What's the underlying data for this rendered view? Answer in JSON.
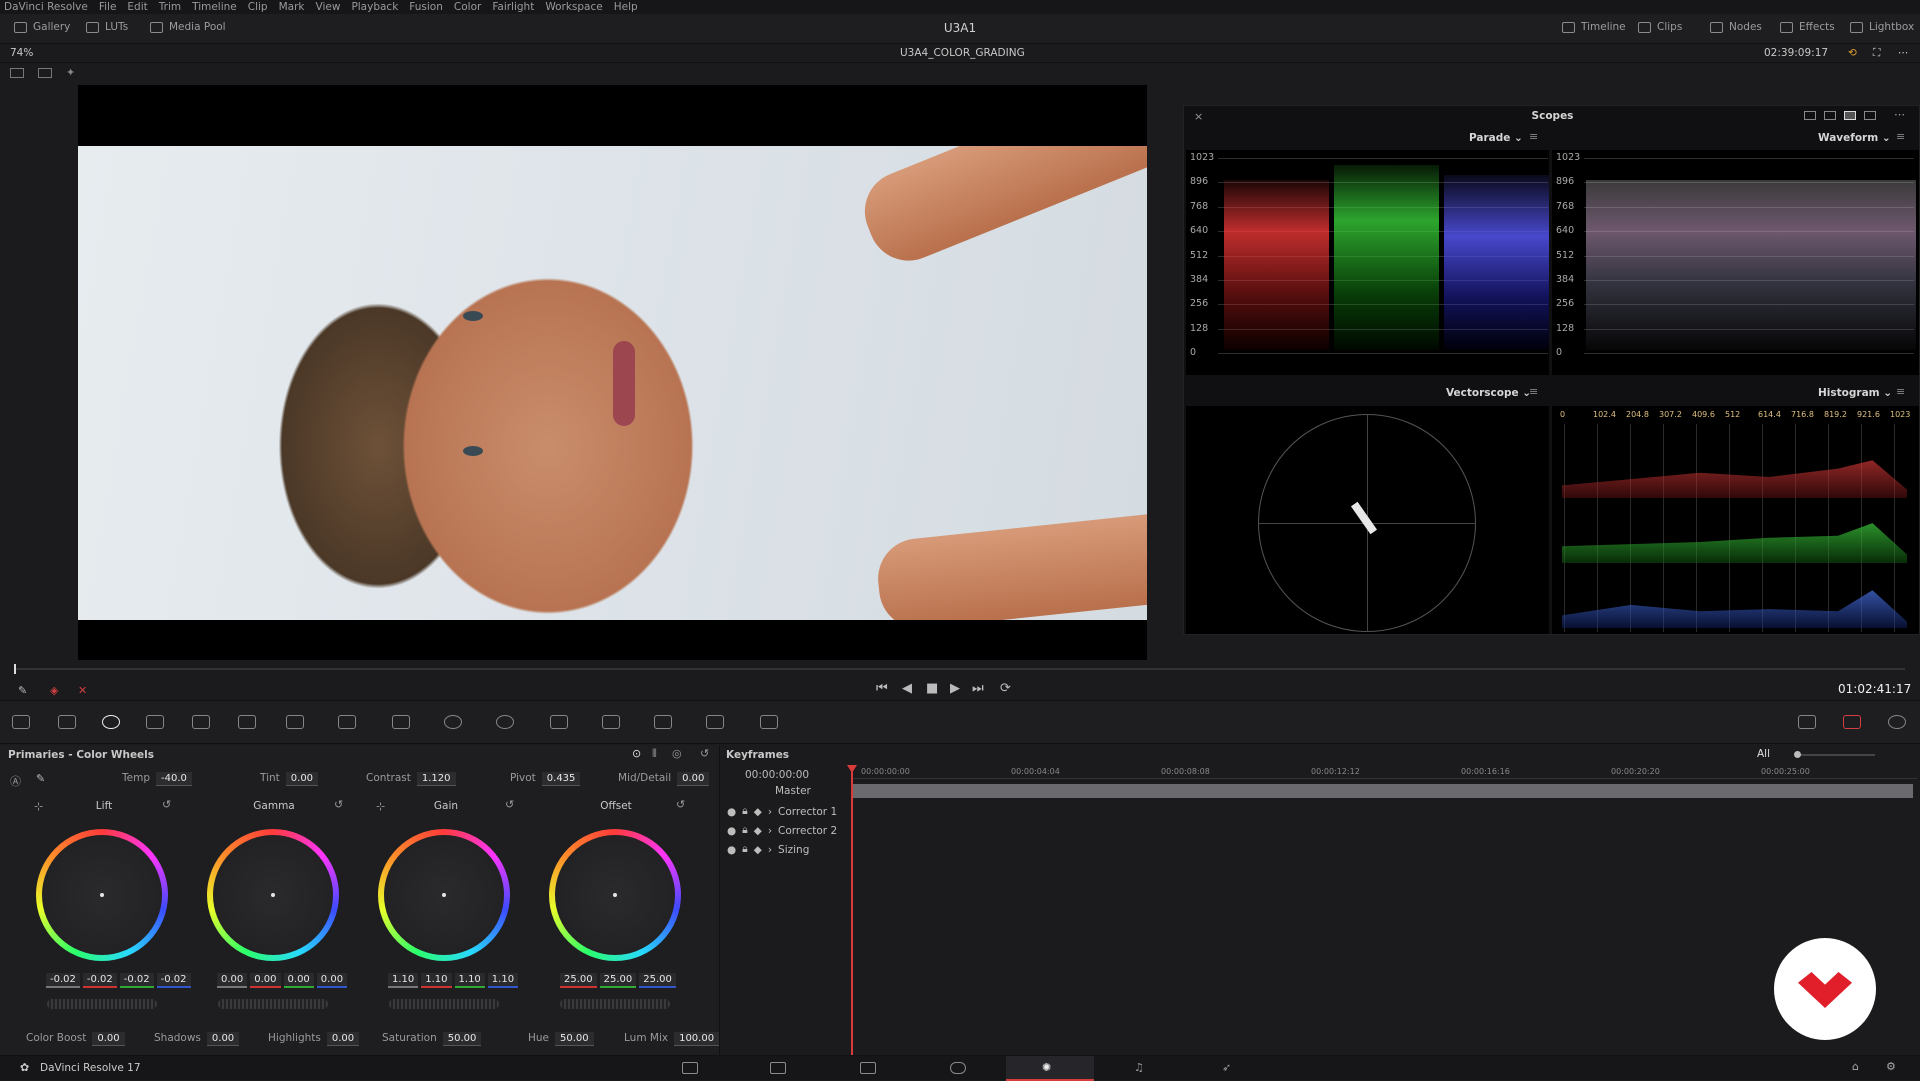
{
  "menu": [
    "DaVinci Resolve",
    "File",
    "Edit",
    "Trim",
    "Timeline",
    "Clip",
    "Mark",
    "View",
    "Playback",
    "Fusion",
    "Color",
    "Fairlight",
    "Workspace",
    "Help"
  ],
  "toolbar": {
    "left": [
      {
        "label": "Gallery",
        "icon": "gallery-icon"
      },
      {
        "label": "LUTs",
        "icon": "luts-icon"
      },
      {
        "label": "Media Pool",
        "icon": "media-pool-icon"
      }
    ],
    "title": "U3A1",
    "right": [
      {
        "label": "Timeline",
        "icon": "timeline-icon"
      },
      {
        "label": "Clips",
        "icon": "clips-icon"
      },
      {
        "label": "Nodes",
        "icon": "nodes-icon"
      },
      {
        "label": "Effects",
        "icon": "effects-icon"
      },
      {
        "label": "Lightbox",
        "icon": "lightbox-icon"
      }
    ]
  },
  "viewer": {
    "zoom": "74%",
    "timeline_name": "U3A4_COLOR_GRADING",
    "timecode": "02:39:09:17"
  },
  "scopes": {
    "title": "Scopes",
    "parade_label": "Parade",
    "waveform_label": "Waveform",
    "vectorscope_label": "Vectorscope",
    "histogram_label": "Histogram",
    "y_ticks": [
      "1023",
      "896",
      "768",
      "640",
      "512",
      "384",
      "256",
      "128",
      "0"
    ],
    "hist_ticks": [
      "0",
      "102.4",
      "204.8",
      "307.2",
      "409.6",
      "512",
      "614.4",
      "716.8",
      "819.2",
      "921.6",
      "1023"
    ]
  },
  "transport": {
    "timecode": "01:02:41:17"
  },
  "primaries": {
    "title": "Primaries - Color Wheels",
    "top_params": [
      {
        "label": "Temp",
        "value": "-40.0"
      },
      {
        "label": "Tint",
        "value": "0.00"
      },
      {
        "label": "Contrast",
        "value": "1.120"
      },
      {
        "label": "Pivot",
        "value": "0.435"
      },
      {
        "label": "Mid/Detail",
        "value": "0.00"
      }
    ],
    "wheels": [
      {
        "label": "Lift",
        "values": [
          "-0.02",
          "-0.02",
          "-0.02",
          "-0.02"
        ]
      },
      {
        "label": "Gamma",
        "values": [
          "0.00",
          "0.00",
          "0.00",
          "0.00"
        ]
      },
      {
        "label": "Gain",
        "values": [
          "1.10",
          "1.10",
          "1.10",
          "1.10"
        ]
      },
      {
        "label": "Offset",
        "values": [
          "25.00",
          "25.00",
          "25.00"
        ]
      }
    ],
    "bottom_params": [
      {
        "label": "Color Boost",
        "value": "0.00"
      },
      {
        "label": "Shadows",
        "value": "0.00"
      },
      {
        "label": "Highlights",
        "value": "0.00"
      },
      {
        "label": "Saturation",
        "value": "50.00"
      },
      {
        "label": "Hue",
        "value": "50.00"
      },
      {
        "label": "Lum Mix",
        "value": "100.00"
      }
    ]
  },
  "keyframes": {
    "title": "Keyframes",
    "filter": "All",
    "start": "00:00:00:00",
    "ruler": [
      "00:00:00:00",
      "00:00:04:04",
      "00:00:08:08",
      "00:00:12:12",
      "00:00:16:16",
      "00:00:20:20",
      "00:00:25:00"
    ],
    "tracks": [
      "Master",
      "Corrector 1",
      "Corrector 2",
      "Sizing"
    ]
  },
  "status": {
    "app": "DaVinci Resolve 17"
  },
  "colors": {
    "accent": "#e23a3a",
    "background": "#1b1b1d"
  }
}
